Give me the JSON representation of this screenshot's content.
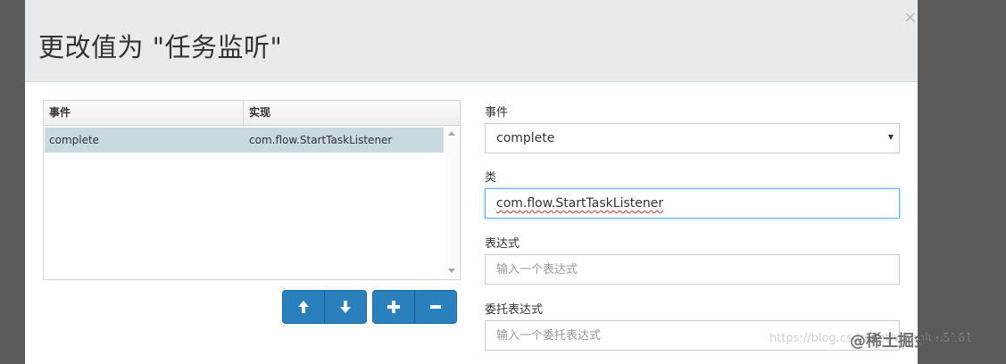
{
  "dialog": {
    "title": "更改值为 \"任务监听\"",
    "close_glyph": "×"
  },
  "grid": {
    "columns": [
      "事件",
      "实现"
    ],
    "rows": [
      {
        "event": "complete",
        "implementation": "com.flow.StartTaskListener"
      }
    ]
  },
  "buttons": [
    {
      "name": "move-up-icon"
    },
    {
      "name": "move-down-icon"
    },
    {
      "name": "add-icon"
    },
    {
      "name": "remove-icon"
    }
  ],
  "form": {
    "event_label": "事件",
    "event_value": "complete",
    "class_label": "类",
    "class_value": "com.flow.StartTaskListener",
    "expression_label": "表达式",
    "expression_placeholder": "输入一个表达式",
    "delegate_label": "委托表达式",
    "delegate_placeholder": "输入一个委托表达式"
  },
  "watermark": {
    "url": "https://blog.csdn.net/wangjun5161",
    "site": "@稀土掘金技术社区"
  },
  "colors": {
    "primary_button": "#2a7fbd",
    "selected_row": "#c8dadf",
    "header_bg": "#e8ebee"
  }
}
